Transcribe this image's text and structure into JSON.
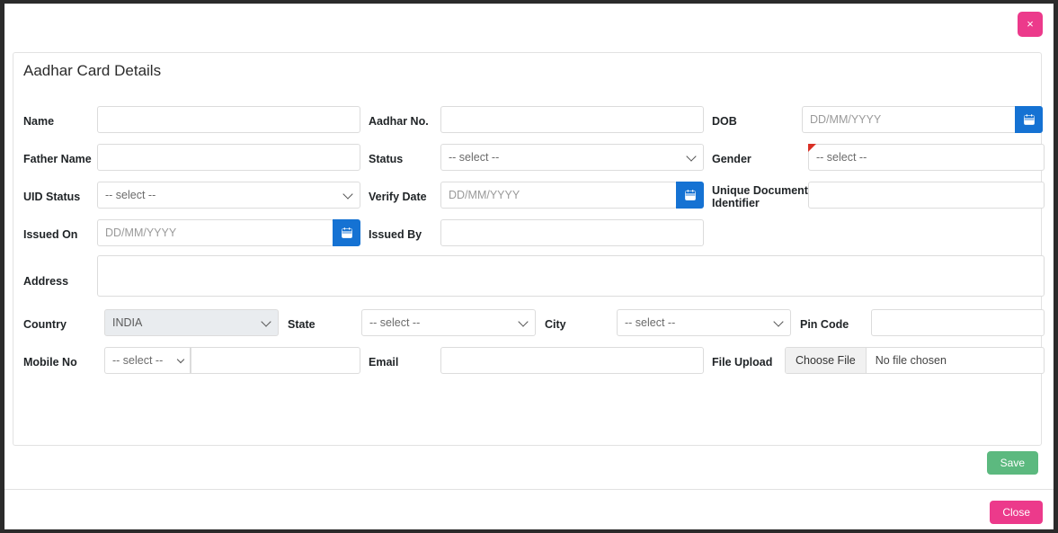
{
  "window": {
    "close_x_label": "×"
  },
  "panel": {
    "title": "Aadhar Card Details"
  },
  "placeholders": {
    "date": "DD/MM/YYYY"
  },
  "select_default": "-- select --",
  "fields": {
    "name": {
      "label": "Name",
      "value": "",
      "required": true
    },
    "aadhar_no": {
      "label": "Aadhar No.",
      "value": "",
      "required": true
    },
    "dob": {
      "label": "DOB",
      "value": "",
      "placeholder": "DD/MM/YYYY",
      "required": true
    },
    "father_name": {
      "label": "Father Name",
      "value": "",
      "required": true
    },
    "status": {
      "label": "Status",
      "value": "-- select --",
      "required": false
    },
    "gender": {
      "label": "Gender",
      "value": "-- select --",
      "required": true
    },
    "uid_status": {
      "label": "UID Status",
      "value": "-- select --",
      "required": false
    },
    "verify_date": {
      "label": "Verify Date",
      "value": "",
      "placeholder": "DD/MM/YYYY",
      "required": false
    },
    "unique_document_identifier": {
      "label": "Unique Document Identifier",
      "label_line1": "Unique Document",
      "label_line2": "Identifier",
      "value": "",
      "required": false
    },
    "issued_on": {
      "label": "Issued On",
      "value": "",
      "placeholder": "DD/MM/YYYY",
      "required": true
    },
    "issued_by": {
      "label": "Issued By",
      "value": "",
      "required": false
    },
    "address": {
      "label": "Address",
      "value": "",
      "required": true
    },
    "country": {
      "label": "Country",
      "value": "INDIA",
      "disabled": true
    },
    "state": {
      "label": "State",
      "value": "-- select --"
    },
    "city": {
      "label": "City",
      "value": "-- select --"
    },
    "pin_code": {
      "label": "Pin Code",
      "value": ""
    },
    "mobile_no": {
      "label": "Mobile No",
      "code_value": "-- select --",
      "value": ""
    },
    "email": {
      "label": "Email",
      "value": ""
    },
    "file_upload": {
      "label": "File Upload",
      "button_label": "Choose File",
      "file_status": "No file chosen"
    }
  },
  "buttons": {
    "save": "Save",
    "close": "Close"
  },
  "colors": {
    "accent_pink": "#ec3a8b",
    "accent_green": "#5cb97f",
    "calendar_blue": "#1572d3",
    "required_red": "#d93025"
  }
}
